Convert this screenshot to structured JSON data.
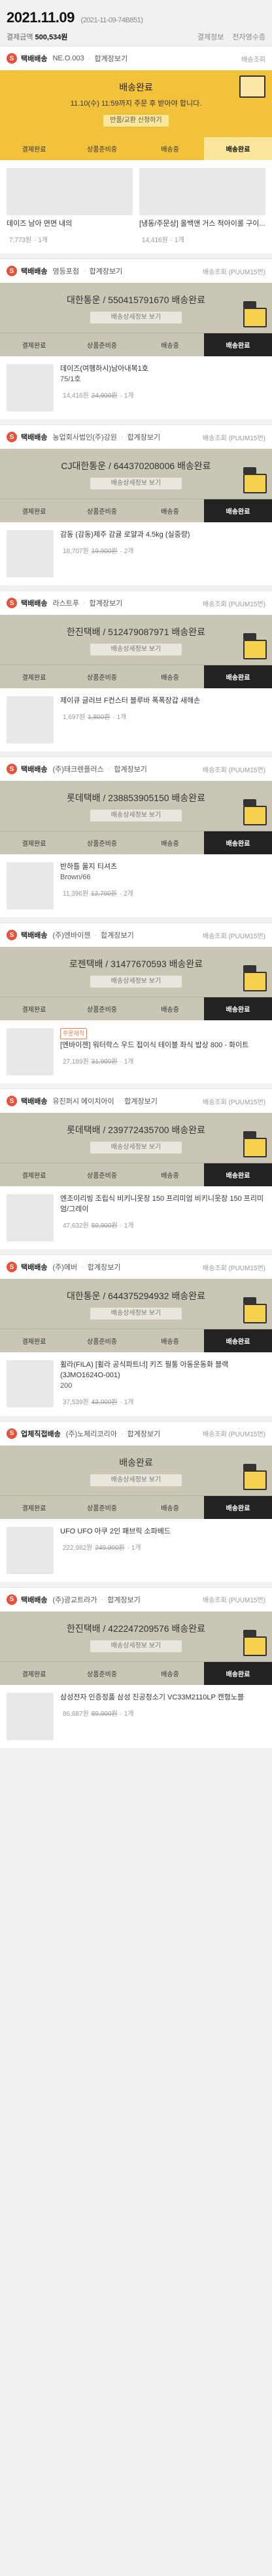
{
  "order": {
    "date": "2021.11.09",
    "order_no": "(2021-11-09-74B851)",
    "payment_label": "결제금액",
    "payment_amount": "500,534원",
    "actions": [
      "결제정보",
      "전자영수증"
    ]
  },
  "groups": [
    {
      "shop_badge": "S",
      "seller": "택배배송",
      "group_sep": "NE.O.003",
      "merge_label": "합계장보기",
      "shipping": "배송조회",
      "hero": {
        "title": "배송완료",
        "note": "11.10(수) 11:59까지 주문 후 받아야 합니다.",
        "button": "반품/교환 신청하기"
      },
      "steps": [
        "결제완료",
        "상품준비중",
        "배송중",
        "배송완료"
      ],
      "active_step": 3,
      "layout": "grid",
      "items": [
        {
          "name": "데이즈 남아 면면 내의",
          "price": "7,773원",
          "qty": "1개"
        },
        {
          "name": "[냉동/주문상] 올백앤 거스 척아이롤 구이...",
          "price": "14,416원",
          "qty": "1개"
        }
      ]
    },
    {
      "shop_badge": "S",
      "seller": "택배배송",
      "group_sep": "영등포점",
      "merge_label": "합계장보기",
      "shipping": "배송조회 (PUUM15번)",
      "panel": {
        "title": "대한통운 / 550415791670 배송완료",
        "button": "배송상세정보 보기"
      },
      "steps": [
        "결제완료",
        "상품준비중",
        "배송중",
        "배송완료"
      ],
      "active_step": 3,
      "layout": "list",
      "items": [
        {
          "name": "데이즈(여행하시)남아내복1호",
          "sub": "75/1호",
          "price": "14,416원",
          "old": "24,900원",
          "qty": "1개"
        }
      ]
    },
    {
      "shop_badge": "S",
      "seller": "택배배송",
      "group_sep": "농업회사법인(주)강원",
      "merge_label": "합계장보기",
      "shipping": "배송조회 (PUUM15번)",
      "panel": {
        "title": "CJ대한통운 / 644370208006 배송완료",
        "button": "배송상세정보 보기"
      },
      "steps": [
        "결제완료",
        "상품준비중",
        "배송중",
        "배송완료"
      ],
      "active_step": 3,
      "layout": "list",
      "items": [
        {
          "name": "감동 (감동)제주 감귤 로얄과 4.5kg (실중량)",
          "price": "18,707원",
          "old": "19,900원",
          "qty": "2개"
        }
      ]
    },
    {
      "shop_badge": "S",
      "seller": "택배배송",
      "group_sep": "라스트푸",
      "merge_label": "합계장보기",
      "shipping": "배송조회 (PUUM15번)",
      "panel": {
        "title": "한진택배 / 512479087971 배송완료",
        "button": "배송상세정보 보기"
      },
      "steps": [
        "결제완료",
        "상품준비중",
        "배송중",
        "배송완료"
      ],
      "active_step": 3,
      "layout": "list",
      "items": [
        {
          "name": "제이큐 글러브 F컨스터 블루바 폭폭장갑 새해손",
          "price": "1,697원",
          "old": "1,800원",
          "qty": "1개"
        }
      ]
    },
    {
      "shop_badge": "S",
      "seller": "택배배송",
      "group_sep": "(주)태크렌플러스",
      "merge_label": "합계장보기",
      "shipping": "배송조회 (PUUM15번)",
      "panel": {
        "title": "롯데택배 / 238853905150 배송완료",
        "button": "배송상세정보 보기"
      },
      "steps": [
        "결제완료",
        "상품준비중",
        "배송중",
        "배송완료"
      ],
      "active_step": 3,
      "layout": "list",
      "items": [
        {
          "name": "반하틀 울지 티셔츠",
          "sub": "Brown/66",
          "price": "11,396원",
          "old": "12,700원",
          "qty": "2개"
        }
      ]
    },
    {
      "shop_badge": "S",
      "seller": "택배배송",
      "group_sep": "(주)엔바이젠",
      "merge_label": "합계장보기",
      "shipping": "배송조회 (PUUM15번)",
      "panel": {
        "title": "로젠택배 / 31477670593 배송완료",
        "button": "배송상세정보 보기"
      },
      "steps": [
        "결제완료",
        "상품준비중",
        "배송중",
        "배송완료"
      ],
      "active_step": 3,
      "layout": "list",
      "items": [
        {
          "tag": "주문제작",
          "name": "[엔바이젠] 워터락스 우드 접이식 테이블 좌식 밥상 800 - 화이트",
          "price": "27,189원",
          "old": "31,900원",
          "qty": "1개"
        }
      ]
    },
    {
      "shop_badge": "S",
      "seller": "택배배송",
      "group_sep": "유진퍼시 에이치아이",
      "merge_label": "합계장보기",
      "shipping": "배송조회 (PUUM15번)",
      "panel": {
        "title": "롯데택배 / 239772435700 배송완료",
        "button": "배송상세정보 보기"
      },
      "steps": [
        "결제완료",
        "상품준비중",
        "배송중",
        "배송완료"
      ],
      "active_step": 3,
      "layout": "list",
      "items": [
        {
          "name": "엔조이리빙 조립식 비키니옷장 150 프리미엄 비키니옷장 150 프리미엄/그레이",
          "price": "47,632원",
          "old": "50,900원",
          "qty": "1개"
        }
      ]
    },
    {
      "shop_badge": "S",
      "seller": "택배배송",
      "group_sep": "(주)에버",
      "merge_label": "합계장보기",
      "shipping": "배송조회 (PUUM15번)",
      "panel": {
        "title": "대한통운 / 644375294932 배송완료",
        "button": "배송상세정보 보기"
      },
      "steps": [
        "결제완료",
        "상품준비중",
        "배송중",
        "배송완료"
      ],
      "active_step": 3,
      "layout": "list",
      "items": [
        {
          "name": "휠라(FILA) [휠라 공식파트너] 키즈 필통 아동운동화 블랙(3JMO1624O-001)",
          "sub": "200",
          "price": "37,539원",
          "old": "43,000원",
          "qty": "1개"
        }
      ]
    },
    {
      "shop_badge": "S",
      "seller": "업체직접배송",
      "group_sep": "(주)노체리코리아",
      "merge_label": "합계장보기",
      "shipping": "배송조회 (PUUM15번)",
      "panel": {
        "title": "배송완료",
        "button": "배송상세정보 보기"
      },
      "steps": [
        "결제완료",
        "상품준비중",
        "배송중",
        "배송완료"
      ],
      "active_step": 3,
      "layout": "list",
      "items": [
        {
          "name": "UFO UFO 아쿠 2인 패브릭 소파베드",
          "price": "222,982원",
          "old": "249,900원",
          "qty": "1개"
        }
      ]
    },
    {
      "shop_badge": "S",
      "seller": "택배배송",
      "group_sep": "(주)광교트라가",
      "merge_label": "합계장보기",
      "shipping": "배송조회 (PUUM15번)",
      "panel": {
        "title": "한진택배 / 422247209576 배송완료",
        "button": "배송상세정보 보기"
      },
      "steps": [
        "결제완료",
        "상품준비중",
        "배송중",
        "배송완료"
      ],
      "active_step": 3,
      "layout": "list",
      "items": [
        {
          "name": "삼성전자 인증정품 삼성 진공청소기 VC33M2110LP 캔형노블",
          "price": "86,687원",
          "old": "89,900원",
          "qty": "1개"
        }
      ]
    }
  ]
}
